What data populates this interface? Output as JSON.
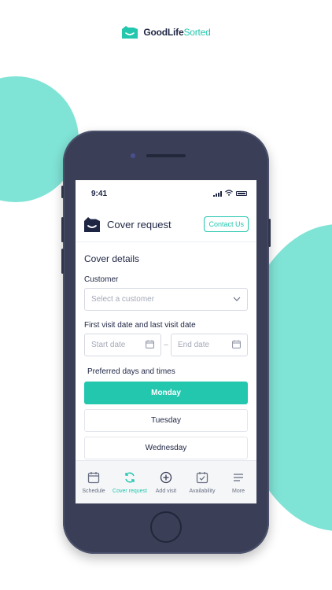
{
  "brand": {
    "name_main": "GoodLife",
    "name_accent": "Sorted",
    "logo_icon": "smile-house-icon"
  },
  "colors": {
    "accent": "#22c7ae",
    "navy": "#1e2543",
    "blob": "#7fe3d5",
    "phone": "#3a3f57"
  },
  "status": {
    "time": "9:41"
  },
  "header": {
    "title": "Cover request",
    "contact_label": "Contact Us",
    "logo_icon": "smile-house-icon"
  },
  "form": {
    "section_title": "Cover details",
    "customer_label": "Customer",
    "customer_placeholder": "Select a customer",
    "dates_label": "First visit date and last visit date",
    "start_placeholder": "Start date",
    "end_placeholder": "End date",
    "dash": "–",
    "preferred_label": "Preferred days and times",
    "days": [
      {
        "label": "Monday",
        "selected": true
      },
      {
        "label": "Tuesday",
        "selected": false
      },
      {
        "label": "Wednesday",
        "selected": false
      }
    ]
  },
  "tabs": [
    {
      "label": "Schedule",
      "icon": "calendar-icon",
      "active": false
    },
    {
      "label": "Cover request",
      "icon": "refresh-icon",
      "active": true
    },
    {
      "label": "Add visit",
      "icon": "plus-circle-icon",
      "active": false
    },
    {
      "label": "Availability",
      "icon": "calendar-check-icon",
      "active": false
    },
    {
      "label": "More",
      "icon": "menu-icon",
      "active": false
    }
  ]
}
